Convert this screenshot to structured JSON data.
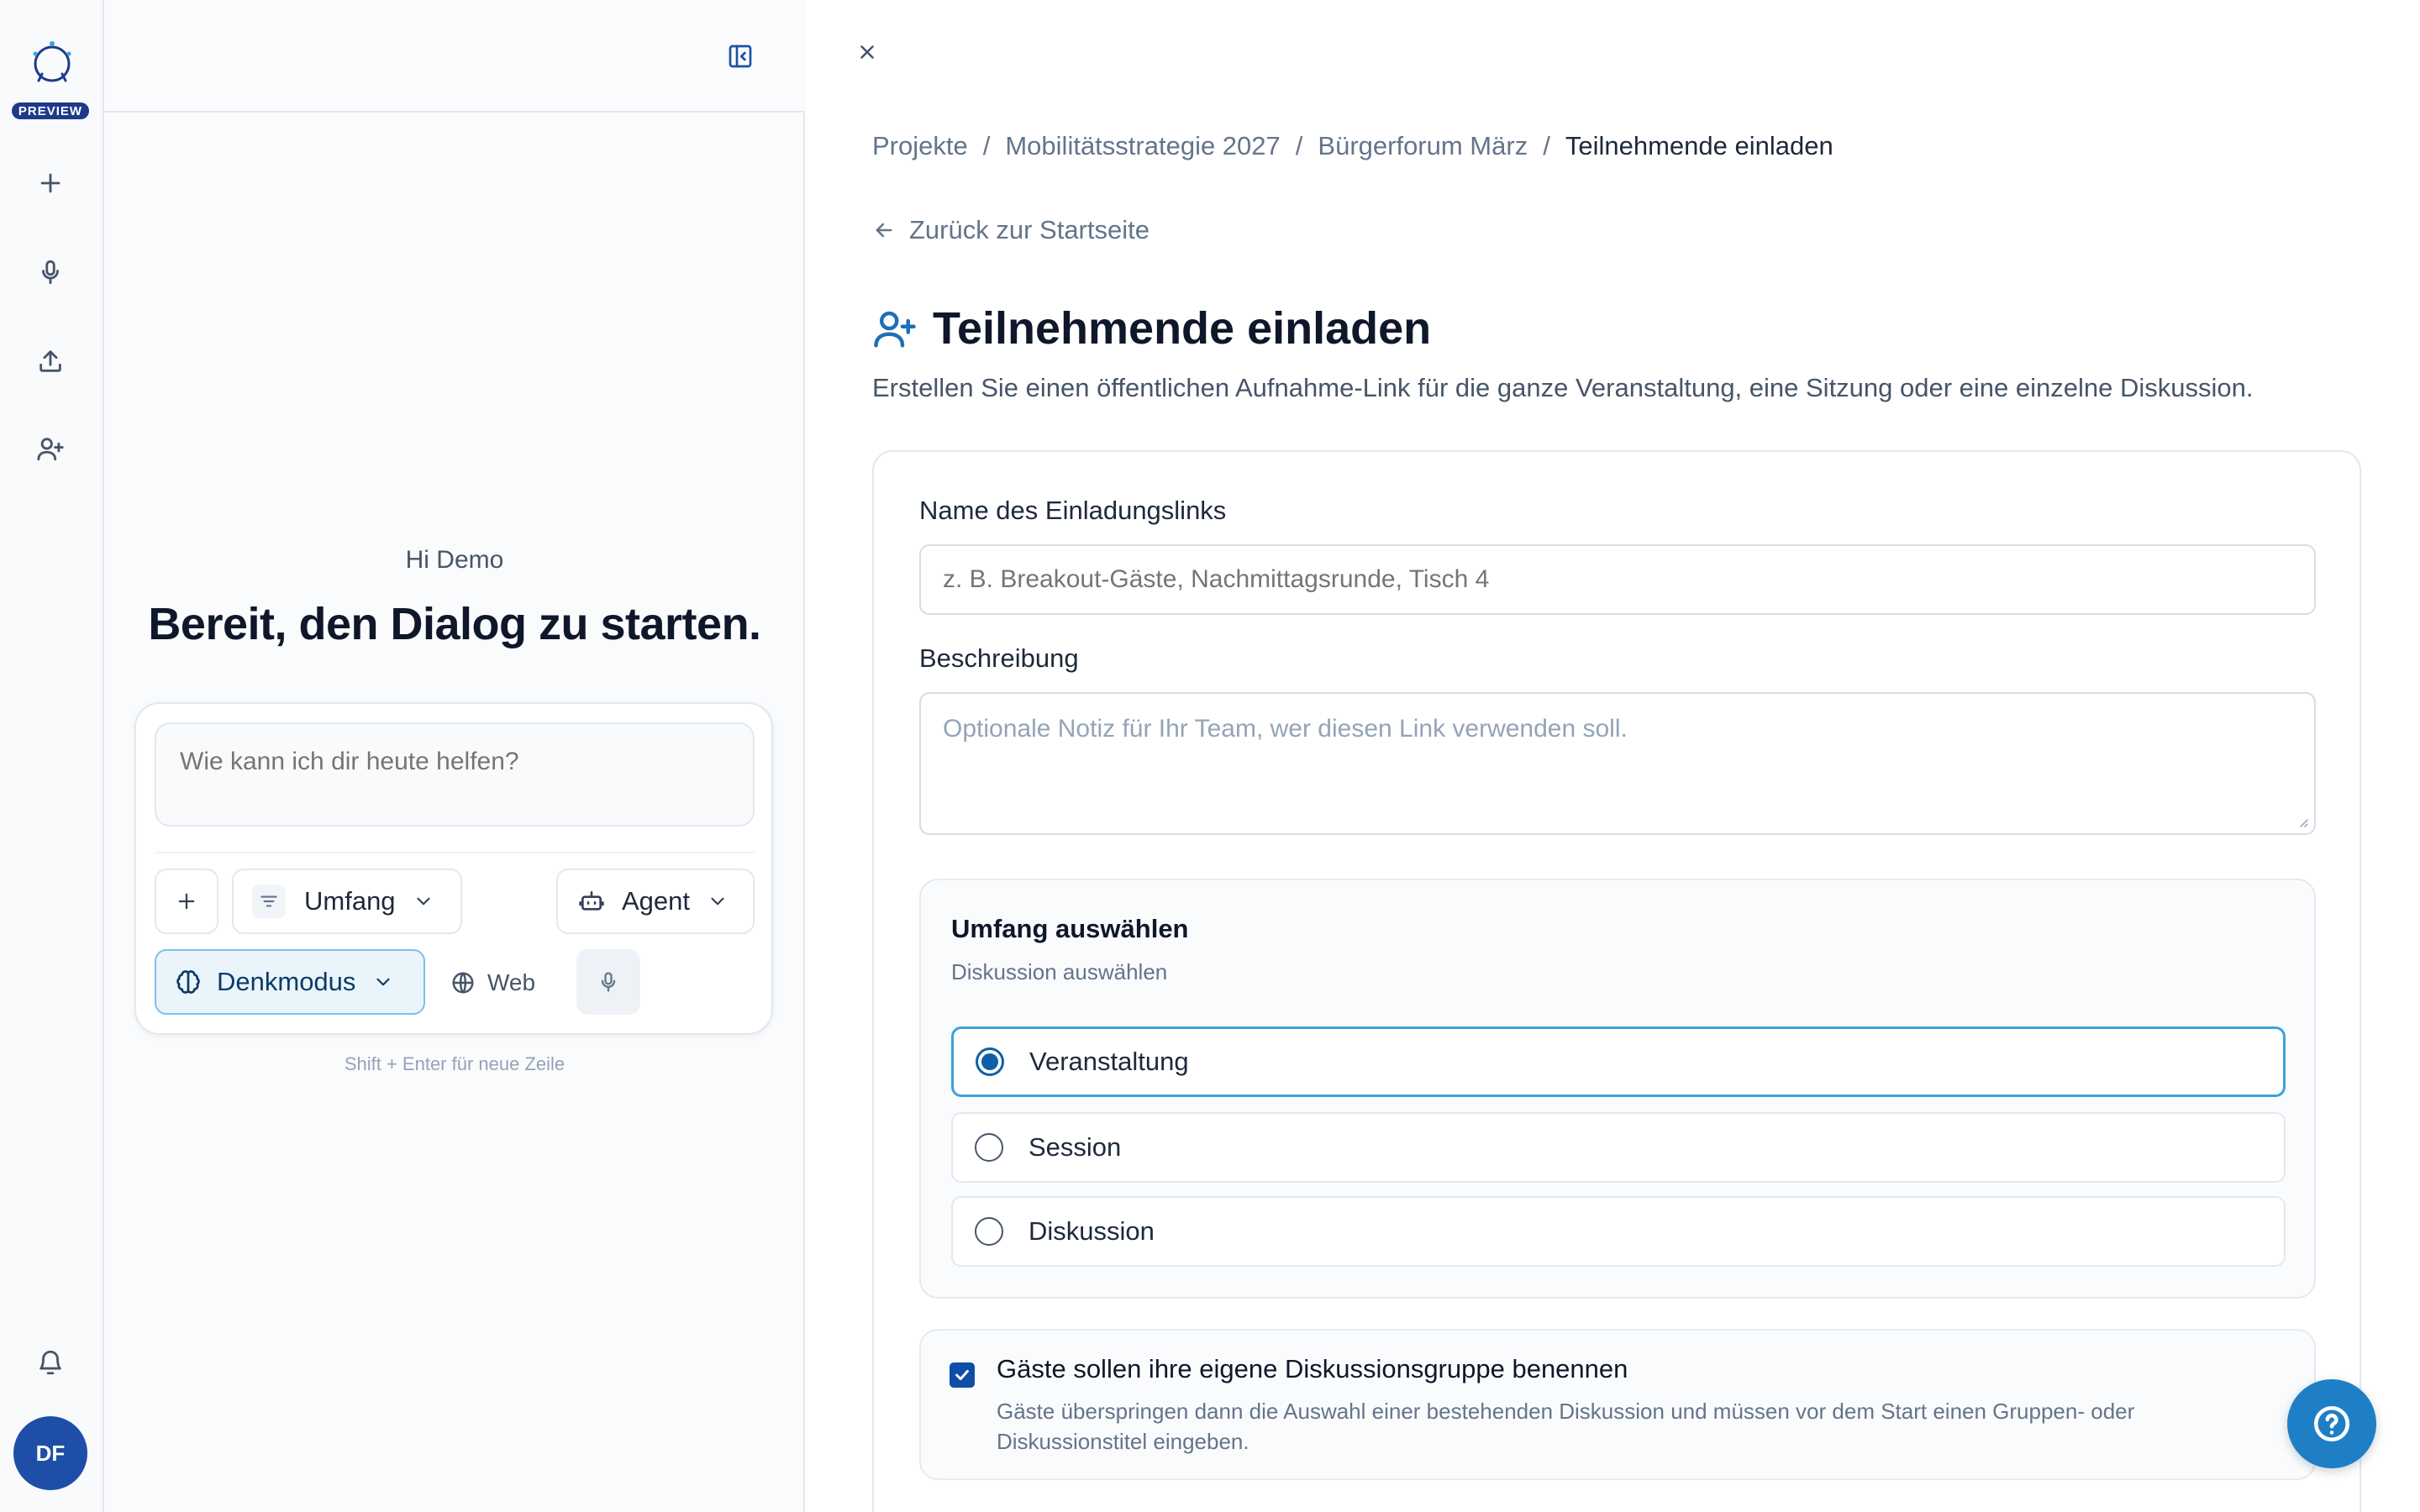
{
  "rail": {
    "badge": "PREVIEW",
    "avatar_initials": "DF",
    "icons": [
      "logo-icon",
      "plus-icon",
      "mic-icon",
      "upload-icon",
      "user-plus-icon",
      "bell-icon"
    ]
  },
  "chat": {
    "greeting": "Hi Demo",
    "hero": "Bereit, den Dialog zu starten.",
    "input_placeholder": "Wie kann ich dir heute helfen?",
    "scope_label": "Umfang",
    "agent_label": "Agent",
    "mode_label": "Denkmodus",
    "web_label": "Web",
    "hint": "Shift + Enter für neue Zeile"
  },
  "main": {
    "breadcrumb": [
      "Projekte",
      "Mobilitätsstrategie 2027",
      "Bürgerforum März",
      "Teilnehmende einladen"
    ],
    "back_label": "Zurück zur Startseite",
    "title": "Teilnehmende einladen",
    "subtitle": "Erstellen Sie einen öffentlichen Aufnahme-Link für die ganze Veranstaltung, eine Sitzung oder eine einzelne Diskussion.",
    "form": {
      "name_label": "Name des Einladungslinks",
      "name_placeholder": "z. B. Breakout-Gäste, Nachmittagsrunde, Tisch 4",
      "desc_label": "Beschreibung",
      "desc_placeholder": "Optionale Notiz für Ihr Team, wer diesen Link verwenden soll.",
      "scope": {
        "title": "Umfang auswählen",
        "subtitle": "Diskussion auswählen",
        "options": [
          "Veranstaltung",
          "Session",
          "Diskussion"
        ],
        "selected": "Veranstaltung"
      },
      "guest_naming": {
        "checked": true,
        "title": "Gäste sollen ihre eigene Diskussionsgruppe benennen",
        "description": "Gäste überspringen dann die Auswahl einer bestehenden Diskussion und müssen vor dem Start einen Gruppen- oder Diskussionstitel eingeben."
      }
    }
  },
  "colors": {
    "accent": "#1e7fc6",
    "selected_border": "#3aa3da",
    "avatar": "#1e4ea8"
  }
}
